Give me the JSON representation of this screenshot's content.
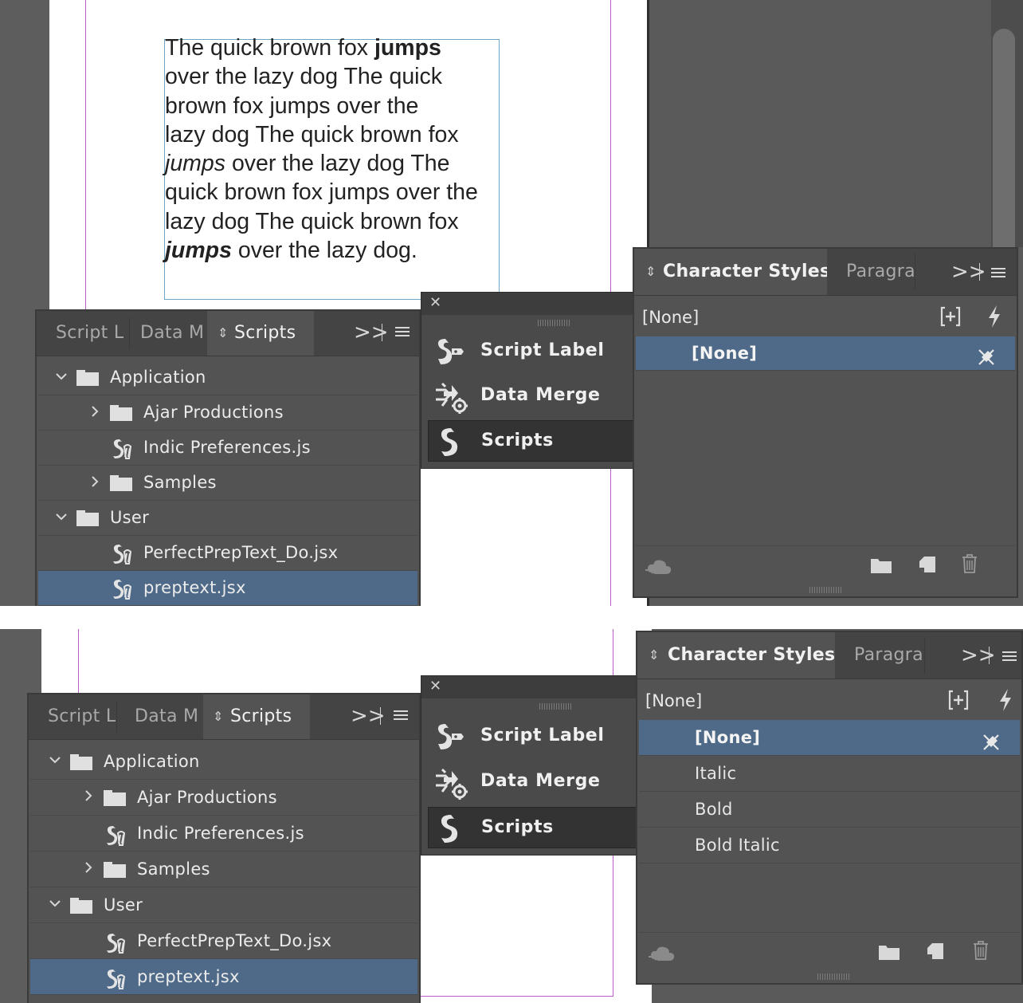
{
  "story": {
    "line1": "The quick brown fox ",
    "line1_bold": "jumps",
    "line2": "over the lazy dog The quick",
    "line3": "brown fox jumps over the",
    "line4": "lazy dog The quick brown fox",
    "line5_italic": "jumps",
    "line5": " over the lazy dog The",
    "line6": "quick brown fox jumps over the",
    "line7": "lazy dog The quick brown fox",
    "line8_bolditalic": "jumps",
    "line8": " over the lazy dog."
  },
  "scripts_panel": {
    "tabs": [
      "Script L",
      "Data M",
      "Scripts"
    ],
    "overflow": ">>",
    "tree": [
      {
        "label": "Application",
        "type": "folder",
        "expanded": true,
        "level": 0
      },
      {
        "label": "Ajar Productions",
        "type": "folder",
        "expanded": false,
        "level": 1
      },
      {
        "label": "Indic Preferences.js",
        "type": "script",
        "level": 1
      },
      {
        "label": "Samples",
        "type": "folder",
        "expanded": false,
        "level": 1
      },
      {
        "label": "User",
        "type": "folder",
        "expanded": true,
        "level": 0
      },
      {
        "label": "PerfectPrepText_Do.jsx",
        "type": "script",
        "level": 1
      },
      {
        "label": "preptext.jsx",
        "type": "script",
        "level": 1,
        "selected": true
      }
    ]
  },
  "float_menu": {
    "items": [
      {
        "label": "Script Label",
        "icon": "script-label-icon"
      },
      {
        "label": "Data Merge",
        "icon": "data-merge-icon"
      },
      {
        "label": "Scripts",
        "icon": "scripts-icon",
        "active": true
      }
    ]
  },
  "char_styles_panel": {
    "tabs": [
      "Character Styles",
      "Paragra"
    ],
    "overflow": ">>",
    "current": "[None]",
    "items_top": [
      "[None]"
    ],
    "items_bottom": [
      "[None]",
      "Italic",
      "Bold",
      "Bold Italic"
    ]
  },
  "colors": {
    "panel_bg": "#535353",
    "tab_bar": "#444444",
    "selection": "#4e6a88",
    "margin_guide": "#b85fc7",
    "frame_edge": "#6fa6c6"
  }
}
